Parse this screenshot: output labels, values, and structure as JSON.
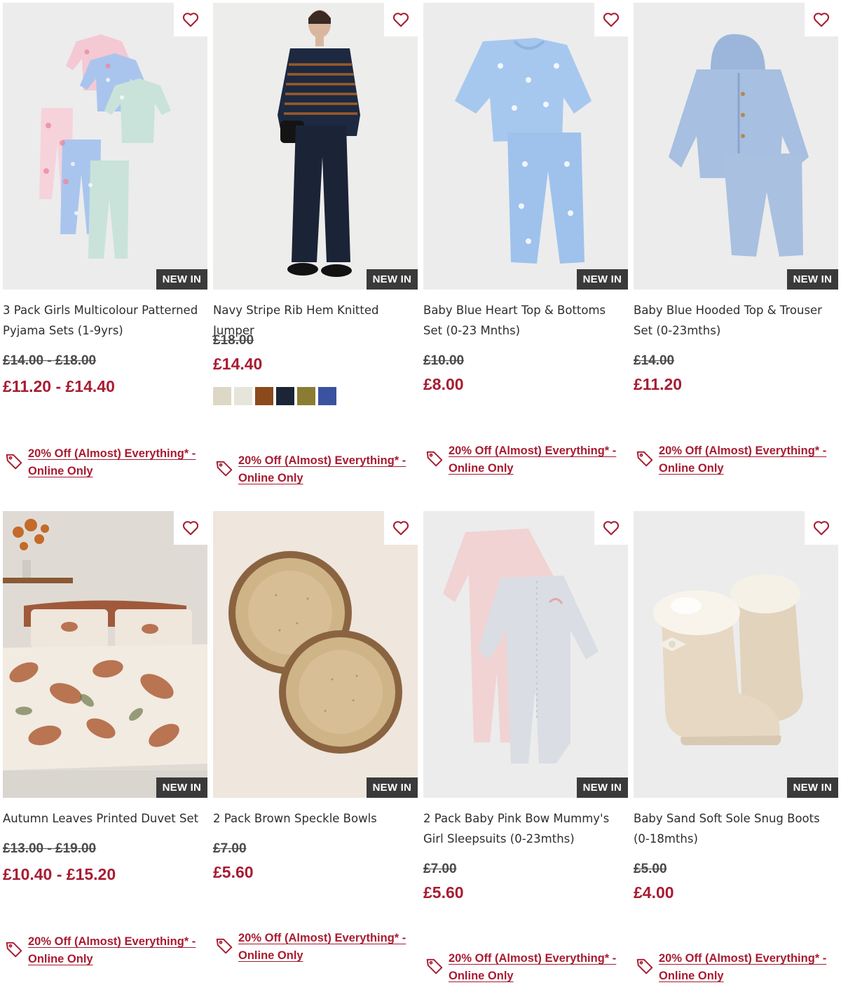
{
  "colors": {
    "accent": "#a81c32",
    "badge_bg": "#3a3a3a",
    "text": "#2e2e2e",
    "image_bg": "#ececec"
  },
  "promo_text": "20% Off (Almost) Everything* - Online Only",
  "products": [
    {
      "title": "3 Pack Girls Multicolour Patterned Pyjama Sets (1-9yrs)",
      "badge": "NEW IN",
      "was_price": "£14.00 - £18.00",
      "now_price": "£11.20 - £14.40",
      "promo": "20% Off (Almost) Everything* - Online Only",
      "wishlist_icon": "heart-outline-icon",
      "promo_icon": "price-tag-icon"
    },
    {
      "title": "Navy Stripe Rib Hem Knitted Jumper",
      "badge": "NEW IN",
      "was_price": "£18.00",
      "now_price": "£14.40",
      "promo": "20% Off (Almost) Everything* - Online Only",
      "swatches": [
        "#ddd7c6",
        "#e6e5da",
        "#8a4a1c",
        "#1b2535",
        "#8a7d33",
        "#3a52a0"
      ],
      "wishlist_icon": "heart-outline-icon",
      "promo_icon": "price-tag-icon"
    },
    {
      "title": "Baby Blue Heart Top & Bottoms Set (0-23 Mnths)",
      "badge": "NEW IN",
      "was_price": "£10.00",
      "now_price": "£8.00",
      "promo": "20% Off (Almost) Everything* - Online Only",
      "wishlist_icon": "heart-outline-icon",
      "promo_icon": "price-tag-icon"
    },
    {
      "title": "Baby Blue Hooded Top & Trouser Set (0-23mths)",
      "badge": "NEW IN",
      "was_price": "£14.00",
      "now_price": "£11.20",
      "promo": "20% Off (Almost) Everything* - Online Only",
      "wishlist_icon": "heart-outline-icon",
      "promo_icon": "price-tag-icon"
    },
    {
      "title": "Autumn Leaves Printed Duvet Set",
      "badge": "NEW IN",
      "was_price": "£13.00 - £19.00",
      "now_price": "£10.40 - £15.20",
      "promo": "20% Off (Almost) Everything* - Online Only",
      "wishlist_icon": "heart-outline-icon",
      "promo_icon": "price-tag-icon"
    },
    {
      "title": "2 Pack Brown Speckle Bowls",
      "badge": "NEW IN",
      "was_price": "£7.00",
      "now_price": "£5.60",
      "promo": "20% Off (Almost) Everything* - Online Only",
      "wishlist_icon": "heart-outline-icon",
      "promo_icon": "price-tag-icon"
    },
    {
      "title": "2 Pack Baby Pink Bow Mummy's Girl Sleepsuits (0-23mths)",
      "badge": "NEW IN",
      "was_price": "£7.00",
      "now_price": "£5.60",
      "promo": "20% Off (Almost) Everything* - Online Only",
      "wishlist_icon": "heart-outline-icon",
      "promo_icon": "price-tag-icon"
    },
    {
      "title": "Baby Sand Soft Sole Snug Boots (0-18mths)",
      "badge": "NEW IN",
      "was_price": "£5.00",
      "now_price": "£4.00",
      "promo": "20% Off (Almost) Everything* - Online Only",
      "wishlist_icon": "heart-outline-icon",
      "promo_icon": "price-tag-icon"
    }
  ]
}
